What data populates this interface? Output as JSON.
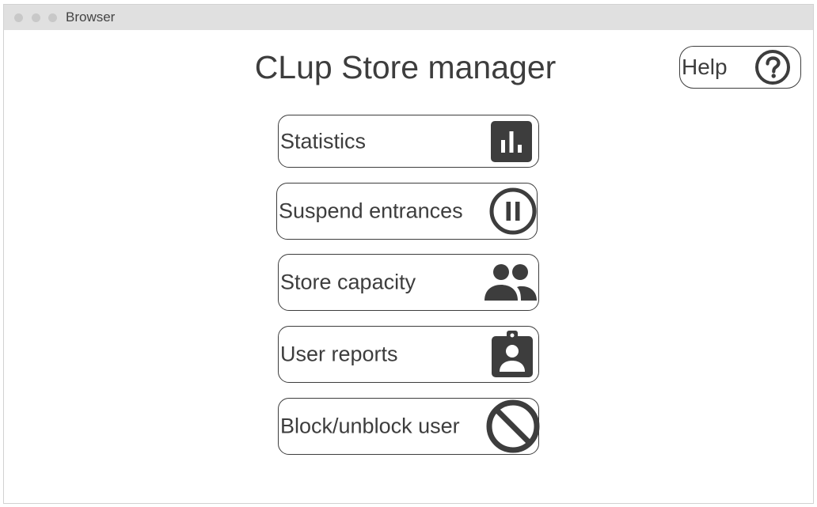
{
  "window": {
    "title": "Browser"
  },
  "page": {
    "title": "CLup Store manager"
  },
  "help": {
    "label": "Help",
    "icon": "help-circle-icon"
  },
  "menu": [
    {
      "label": "Statistics",
      "icon": "bar-chart-icon"
    },
    {
      "label": "Suspend entrances",
      "icon": "pause-circle-icon"
    },
    {
      "label": "Store capacity",
      "icon": "people-icon"
    },
    {
      "label": "User reports",
      "icon": "badge-icon"
    },
    {
      "label": "Block/unblock user",
      "icon": "block-icon"
    }
  ],
  "colors": {
    "foreground": "#3d3d3d",
    "titlebar": "#e0e0e0",
    "window_dots": "#c8c8c8"
  }
}
